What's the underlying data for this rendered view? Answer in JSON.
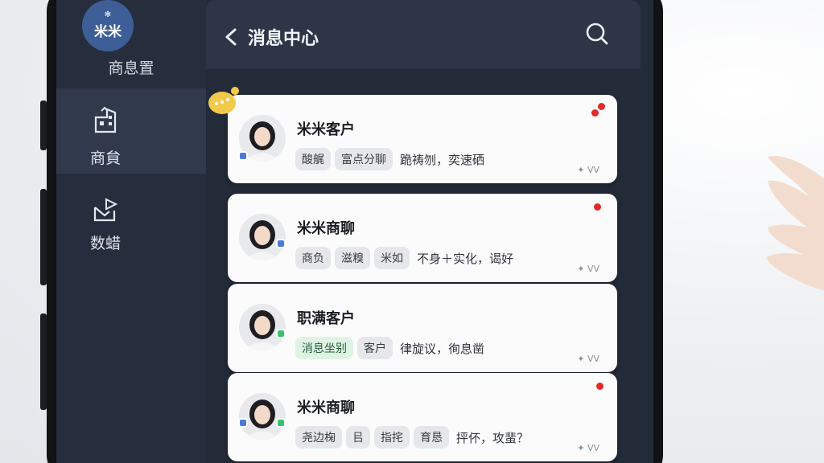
{
  "app": {
    "logo_text": "米米",
    "name": "商息置"
  },
  "sidebar": {
    "items": [
      {
        "label": "商貟",
        "icon": "building-icon",
        "active": true
      },
      {
        "label": "数蜡",
        "icon": "mail-send-icon",
        "active": false
      }
    ]
  },
  "header": {
    "title": "消息中心",
    "back_icon": "back-chevron-icon",
    "search_icon": "search-icon"
  },
  "messages": [
    {
      "name": "米米客户",
      "tags": [
        "酸艉",
        "富点分聊"
      ],
      "preview": "跪祷刎，奕速硒",
      "meta": "✦ ᐯᐯ",
      "unread": true,
      "status_color": "#4a7bd8"
    },
    {
      "name": "米米商聊",
      "tags": [
        "商负",
        "滋糗",
        "米如"
      ],
      "preview": "不身＋实化，谒好",
      "meta": "✦ ᐯᐯ",
      "unread": true,
      "status_color": "#4a7bd8"
    },
    {
      "name": "职满客户",
      "tags": [
        "消息坐别",
        "客户"
      ],
      "preview": "律旋议，徇息凿",
      "meta": "✦ ᐯᐯ",
      "unread": false,
      "status_color": "#3cc36a"
    },
    {
      "name": "米米商聊",
      "tags": [
        "尧边椈",
        "㠯",
        "指挓",
        "育恳"
      ],
      "preview": "抨伓，攻蜚？",
      "meta": "✦ ᐯᐯ",
      "unread": true,
      "status_color": "#4a7bd8"
    }
  ],
  "colors": {
    "accent": "#3d5e96",
    "unread": "#e12a2a",
    "badge": "#f3c94a"
  }
}
